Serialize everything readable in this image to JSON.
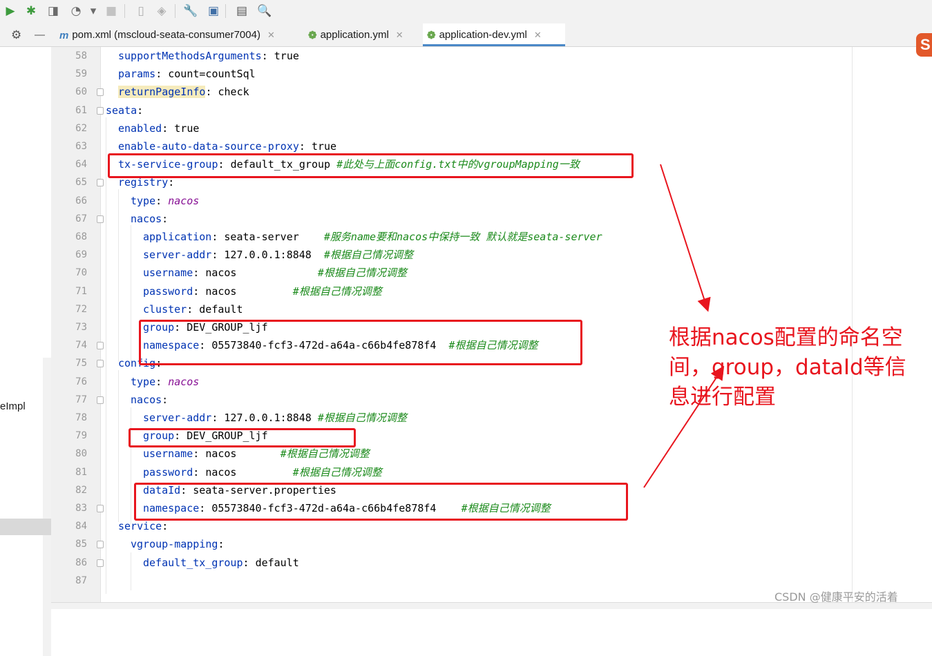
{
  "toolbar": {
    "buttons": [
      {
        "name": "run-icon",
        "glyph": "▶",
        "color": "#3d9b3d"
      },
      {
        "name": "debug-icon",
        "glyph": "✱",
        "color": "#3d9b3d"
      },
      {
        "name": "coverage-icon",
        "glyph": "◨",
        "color": "#6b6b6b"
      },
      {
        "name": "profile-icon",
        "glyph": "◔",
        "color": "#6b6b6b"
      },
      {
        "name": "dropdown-arrow-icon",
        "glyph": "▾",
        "color": "#6b6b6b"
      },
      {
        "name": "stop-icon",
        "glyph": "■",
        "color": "#c3c3c3"
      },
      {
        "name": "device-icon",
        "glyph": "▯",
        "color": "#b0b0b0"
      },
      {
        "name": "build-icon",
        "glyph": "◈",
        "color": "#b0b0b0"
      },
      {
        "name": "wrench-icon",
        "glyph": "🔧",
        "color": "#6b6b6b"
      },
      {
        "name": "project-structure-icon",
        "glyph": "▣",
        "color": "#3f6fa6"
      },
      {
        "name": "terminal-window-icon",
        "glyph": "▤",
        "color": "#555555"
      },
      {
        "name": "search-icon",
        "glyph": "🔍",
        "color": "#444444"
      }
    ]
  },
  "tabbar": {
    "settings_glyph": "⚙",
    "collapse_glyph": "—",
    "tabs": [
      {
        "label": "pom.xml (mscloud-seata-consumer7004)",
        "icon": "maven-icon",
        "icon_glyph": "m",
        "active": false
      },
      {
        "label": "application.yml",
        "icon": "spring-icon",
        "icon_glyph": "❁",
        "active": false
      },
      {
        "label": "application-dev.yml",
        "icon": "spring-icon",
        "icon_glyph": "❁",
        "active": true
      }
    ],
    "close_glyph": "✕"
  },
  "sidebar": {
    "partial_label": "eImpl"
  },
  "editor": {
    "lines": [
      {
        "n": "58",
        "indent": 1,
        "key": "supportMethodsArguments",
        "value": "true",
        "comment": ""
      },
      {
        "n": "59",
        "indent": 1,
        "key": "params",
        "value": "count=countSql",
        "comment": ""
      },
      {
        "n": "60",
        "indent": 1,
        "key": "returnPageInfo",
        "value": "check",
        "comment": "",
        "highlight": true
      },
      {
        "n": "61",
        "indent": 0,
        "key": "seata",
        "value": "",
        "comment": ""
      },
      {
        "n": "62",
        "indent": 1,
        "key": "enabled",
        "value": "true",
        "comment": ""
      },
      {
        "n": "63",
        "indent": 1,
        "key": "enable-auto-data-source-proxy",
        "value": "true",
        "comment": ""
      },
      {
        "n": "64",
        "indent": 1,
        "key": "tx-service-group",
        "value": "default_tx_group ",
        "comment": "#此处与上面config.txt中的vgroupMapping一致"
      },
      {
        "n": "65",
        "indent": 1,
        "key": "registry",
        "value": "",
        "comment": ""
      },
      {
        "n": "66",
        "indent": 2,
        "key": "type",
        "value": "nacos",
        "comment": "",
        "italic": true
      },
      {
        "n": "67",
        "indent": 2,
        "key": "nacos",
        "value": "",
        "comment": ""
      },
      {
        "n": "68",
        "indent": 3,
        "key": "application",
        "value": "seata-server    ",
        "comment": "#服务name要和nacos中保持一致 默认就是seata-server"
      },
      {
        "n": "69",
        "indent": 3,
        "key": "server-addr",
        "value": "127.0.0.1:8848  ",
        "comment": "#根据自己情况调整"
      },
      {
        "n": "70",
        "indent": 3,
        "key": "username",
        "value": "nacos             ",
        "comment": "#根据自己情况调整"
      },
      {
        "n": "71",
        "indent": 3,
        "key": "password",
        "value": "nacos         ",
        "comment": "#根据自己情况调整"
      },
      {
        "n": "72",
        "indent": 3,
        "key": "cluster",
        "value": "default",
        "comment": ""
      },
      {
        "n": "73",
        "indent": 3,
        "key": "group",
        "value": "DEV_GROUP_ljf",
        "comment": ""
      },
      {
        "n": "74",
        "indent": 3,
        "key": "namespace",
        "value": "05573840-fcf3-472d-a64a-c66b4fe878f4  ",
        "comment": "#根据自己情况调整"
      },
      {
        "n": "75",
        "indent": 1,
        "key": "config",
        "value": "",
        "comment": ""
      },
      {
        "n": "76",
        "indent": 2,
        "key": "type",
        "value": "nacos",
        "comment": "",
        "italic": true
      },
      {
        "n": "77",
        "indent": 2,
        "key": "nacos",
        "value": "",
        "comment": ""
      },
      {
        "n": "78",
        "indent": 3,
        "key": "server-addr",
        "value": "127.0.0.1:8848 ",
        "comment": "#根据自己情况调整"
      },
      {
        "n": "79",
        "indent": 3,
        "key": "group",
        "value": "DEV_GROUP_ljf",
        "comment": ""
      },
      {
        "n": "80",
        "indent": 3,
        "key": "username",
        "value": "nacos       ",
        "comment": "#根据自己情况调整"
      },
      {
        "n": "81",
        "indent": 3,
        "key": "password",
        "value": "nacos         ",
        "comment": "#根据自己情况调整"
      },
      {
        "n": "82",
        "indent": 3,
        "key": "dataId",
        "value": "seata-server.properties",
        "comment": ""
      },
      {
        "n": "83",
        "indent": 3,
        "key": "namespace",
        "value": "05573840-fcf3-472d-a64a-c66b4fe878f4    ",
        "comment": "#根据自己情况调整"
      },
      {
        "n": "84",
        "indent": 1,
        "key": "service",
        "value": "",
        "comment": ""
      },
      {
        "n": "85",
        "indent": 2,
        "key": "vgroup-mapping",
        "value": "",
        "comment": ""
      },
      {
        "n": "86",
        "indent": 3,
        "key": "default_tx_group",
        "value": "default",
        "comment": ""
      },
      {
        "n": "87",
        "indent": 0,
        "key": "",
        "value": "",
        "comment": ""
      }
    ]
  },
  "annotation": {
    "text": "根据nacos配置的命名空间，group，dataId等信息进行配置",
    "color": "#e8151e"
  },
  "watermark": "CSDN @健康平安的活着",
  "colors": {
    "key": "#0033b3",
    "comment": "#1b8a1b",
    "italic_value": "#871094",
    "highlight": "#f6ebbc",
    "annotation_red": "#e8151e"
  }
}
